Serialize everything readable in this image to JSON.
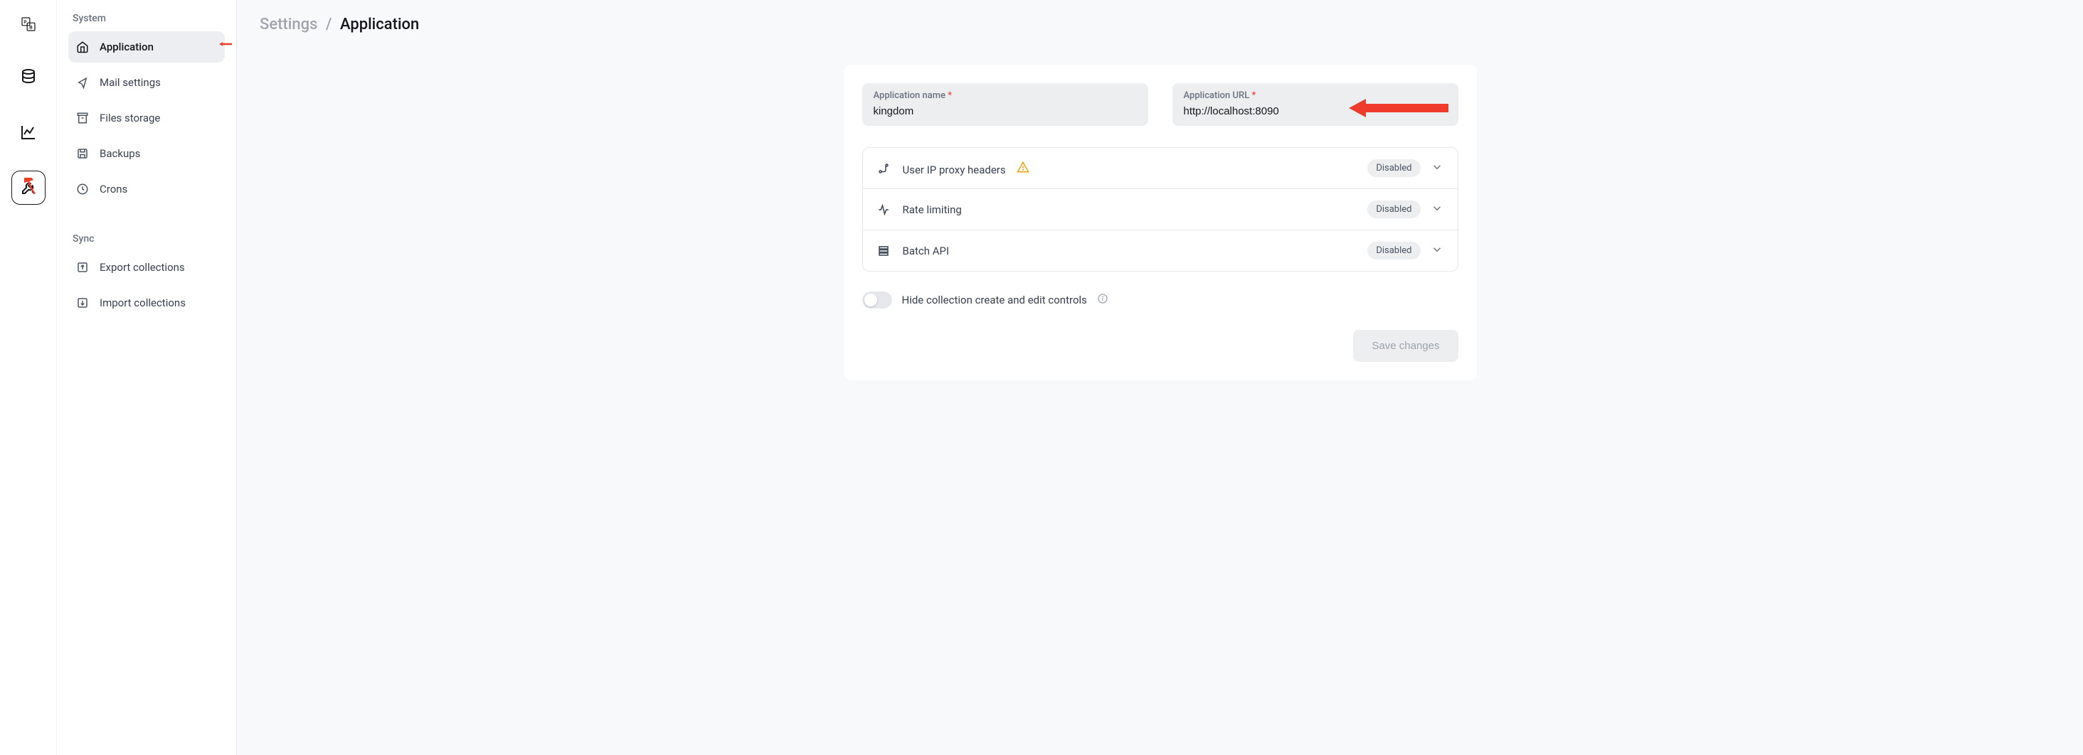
{
  "breadcrumb": {
    "root": "Settings",
    "current": "Application"
  },
  "sidebar": {
    "sections": {
      "system": "System",
      "sync": "Sync"
    },
    "items": {
      "application": "Application",
      "mail": "Mail settings",
      "files": "Files storage",
      "backups": "Backups",
      "crons": "Crons",
      "export": "Export collections",
      "import": "Import collections"
    }
  },
  "form": {
    "appNameLabel": "Application name",
    "appNameValue": "kingdom",
    "appUrlLabel": "Application URL",
    "appUrlValue": "http://localhost:8090"
  },
  "accordion": {
    "proxy": {
      "label": "User IP proxy headers",
      "status": "Disabled"
    },
    "rate": {
      "label": "Rate limiting",
      "status": "Disabled"
    },
    "batch": {
      "label": "Batch API",
      "status": "Disabled"
    }
  },
  "toggle": {
    "hideControls": "Hide collection create and edit controls"
  },
  "buttons": {
    "save": "Save changes"
  }
}
